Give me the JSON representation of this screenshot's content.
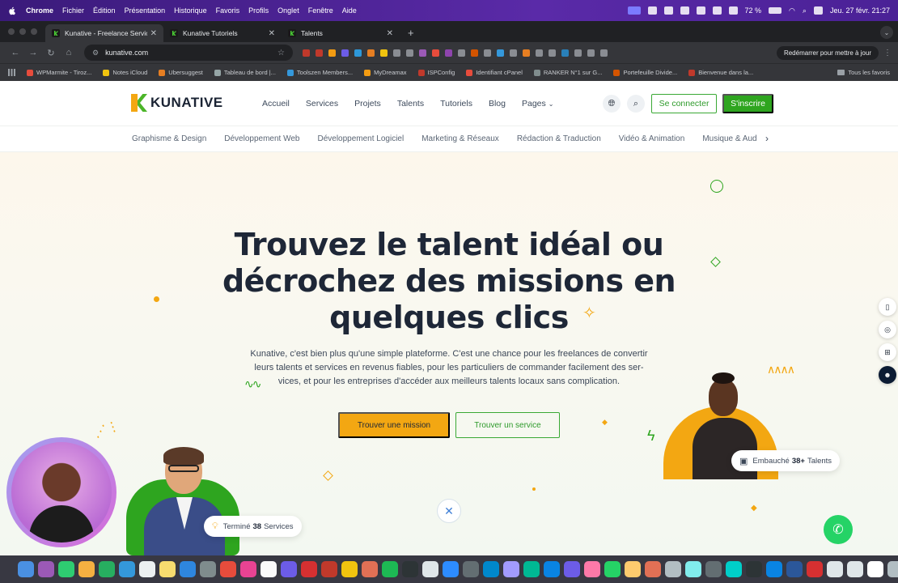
{
  "menubar": {
    "app": "Chrome",
    "items": [
      "Fichier",
      "Édition",
      "Présentation",
      "Historique",
      "Favoris",
      "Profils",
      "Onglet",
      "Fenêtre",
      "Aide"
    ],
    "battery": "72 %",
    "datetime": "Jeu. 27 févr. 21:27"
  },
  "tabs": [
    {
      "title": "Kunative - Freelance Services",
      "active": true
    },
    {
      "title": "Kunative Tutoriels",
      "active": false
    },
    {
      "title": "Talents",
      "active": false
    }
  ],
  "toolbar": {
    "url": "kunative.com",
    "restart_label": "Redémarrer pour mettre à jour"
  },
  "bookmarks": {
    "items": [
      "WPMarmite - Tiroz...",
      "Notes iCloud",
      "Ubersuggest",
      "Tableau de bord |...",
      "Toolszen Members...",
      "MyDreamax",
      "ISPConfig",
      "Identifiant cPanel",
      "RANKER N°1 sur G...",
      "Portefeuille Divide...",
      "Bienvenue dans la..."
    ],
    "all_label": "Tous les favoris"
  },
  "site": {
    "logo": "KUNATIVE",
    "nav": [
      "Accueil",
      "Services",
      "Projets",
      "Talents",
      "Tutoriels",
      "Blog",
      "Pages"
    ],
    "login_label": "Se connecter",
    "signup_label": "S'inscrire",
    "categories": [
      "Graphisme & Design",
      "Développement Web",
      "Développement Logiciel",
      "Marketing & Réseaux",
      "Rédaction & Traduction",
      "Vidéo & Animation",
      "Musique & Audio"
    ],
    "hero_title_lines": [
      "Trouvez le talent idéal ou",
      "décrochez des missions en",
      "quelques clics"
    ],
    "hero_desc_lines": [
      "Kunative, c'est bien plus qu'une simple plateforme. C'est une chance pour les freelances de convertir",
      "leurs talents et services en revenus fiables, pour les particuliers de commander facilement des ser-",
      "vices, et pour les entreprises d'accéder aux meilleurs talents locaux sans complication."
    ],
    "btn_mission": "Trouver une mission",
    "btn_service": "Trouver un service",
    "chip_hired": {
      "prefix": "Embauché",
      "count": "38+",
      "suffix": "Talents"
    },
    "chip_done": {
      "prefix": "Terminé",
      "count": "38",
      "suffix": "Services"
    }
  },
  "colors": {
    "brand_green": "#2ea51f",
    "brand_orange": "#f3a712",
    "heading": "#1e2737"
  }
}
